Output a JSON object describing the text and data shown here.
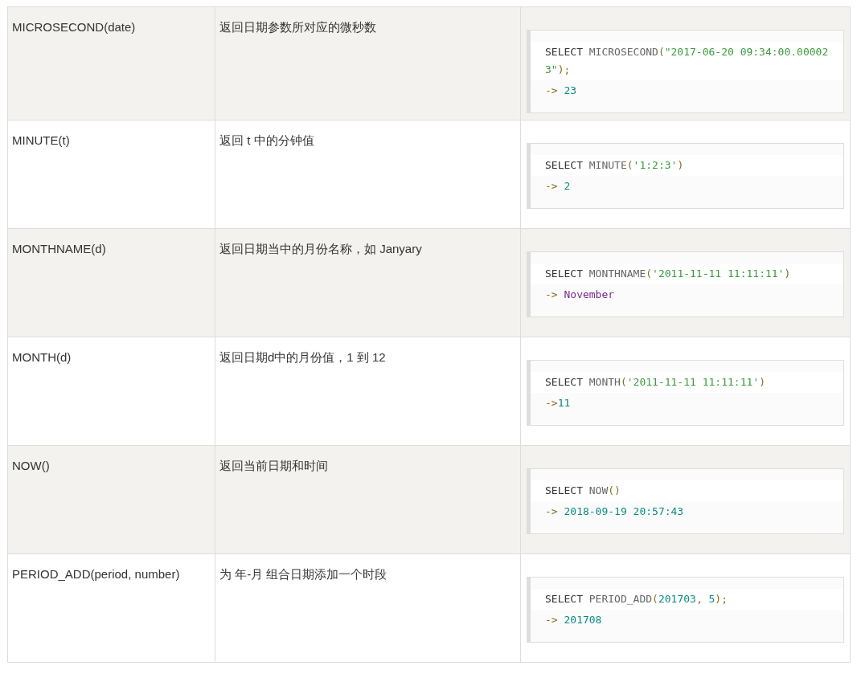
{
  "rows": [
    {
      "function": "MICROSECOND(date)",
      "description": "返回日期参数所对应的微秒数",
      "code": [
        [
          {
            "kind": "kw",
            "text": "SELECT "
          },
          {
            "kind": "fn",
            "text": "MICROSECOND"
          },
          {
            "kind": "punct",
            "text": "("
          },
          {
            "kind": "str",
            "text": "\"2017-06-20 09:34:00.000023\""
          },
          {
            "kind": "punct",
            "text": ");"
          }
        ],
        [
          {
            "kind": "op",
            "text": "-> "
          },
          {
            "kind": "num",
            "text": "23"
          }
        ]
      ]
    },
    {
      "function": "MINUTE(t)",
      "description": "返回 t 中的分钟值",
      "code": [
        [
          {
            "kind": "kw",
            "text": "SELECT "
          },
          {
            "kind": "fn",
            "text": "MINUTE"
          },
          {
            "kind": "punct",
            "text": "("
          },
          {
            "kind": "str",
            "text": "'1:2:3'"
          },
          {
            "kind": "punct",
            "text": ")"
          }
        ],
        [
          {
            "kind": "op",
            "text": "-> "
          },
          {
            "kind": "num",
            "text": "2"
          }
        ]
      ]
    },
    {
      "function": "MONTHNAME(d)",
      "description": "返回日期当中的月份名称，如 Janyary",
      "code": [
        [
          {
            "kind": "kw",
            "text": "SELECT "
          },
          {
            "kind": "fn",
            "text": "MONTHNAME"
          },
          {
            "kind": "punct",
            "text": "("
          },
          {
            "kind": "str",
            "text": "'2011-11-11 11:11:11'"
          },
          {
            "kind": "punct",
            "text": ")"
          }
        ],
        [
          {
            "kind": "op",
            "text": "-> "
          },
          {
            "kind": "word",
            "text": "November"
          }
        ]
      ]
    },
    {
      "function": "MONTH(d)",
      "description": "返回日期d中的月份值，1 到 12",
      "code": [
        [
          {
            "kind": "kw",
            "text": "SELECT "
          },
          {
            "kind": "fn",
            "text": "MONTH"
          },
          {
            "kind": "punct",
            "text": "("
          },
          {
            "kind": "str",
            "text": "'2011-11-11 11:11:11'"
          },
          {
            "kind": "punct",
            "text": ")"
          }
        ],
        [
          {
            "kind": "op",
            "text": "->"
          },
          {
            "kind": "num",
            "text": "11"
          }
        ]
      ]
    },
    {
      "function": "NOW()",
      "description": "返回当前日期和时间",
      "code": [
        [
          {
            "kind": "kw",
            "text": "SELECT "
          },
          {
            "kind": "fn",
            "text": "NOW"
          },
          {
            "kind": "punct",
            "text": "()"
          }
        ],
        [
          {
            "kind": "op",
            "text": "-> "
          },
          {
            "kind": "num",
            "text": "2018-09-19 20:57:43"
          }
        ]
      ]
    },
    {
      "function": "PERIOD_ADD(period, number)",
      "description": "为 年-月 组合日期添加一个时段",
      "code": [
        [
          {
            "kind": "kw",
            "text": "SELECT "
          },
          {
            "kind": "fn",
            "text": "PERIOD_ADD"
          },
          {
            "kind": "punct",
            "text": "("
          },
          {
            "kind": "num",
            "text": "201703"
          },
          {
            "kind": "punct",
            "text": ", "
          },
          {
            "kind": "num",
            "text": "5"
          },
          {
            "kind": "punct",
            "text": ");"
          }
        ],
        [
          {
            "kind": "op",
            "text": "-> "
          },
          {
            "kind": "num",
            "text": "201708"
          }
        ]
      ]
    }
  ]
}
